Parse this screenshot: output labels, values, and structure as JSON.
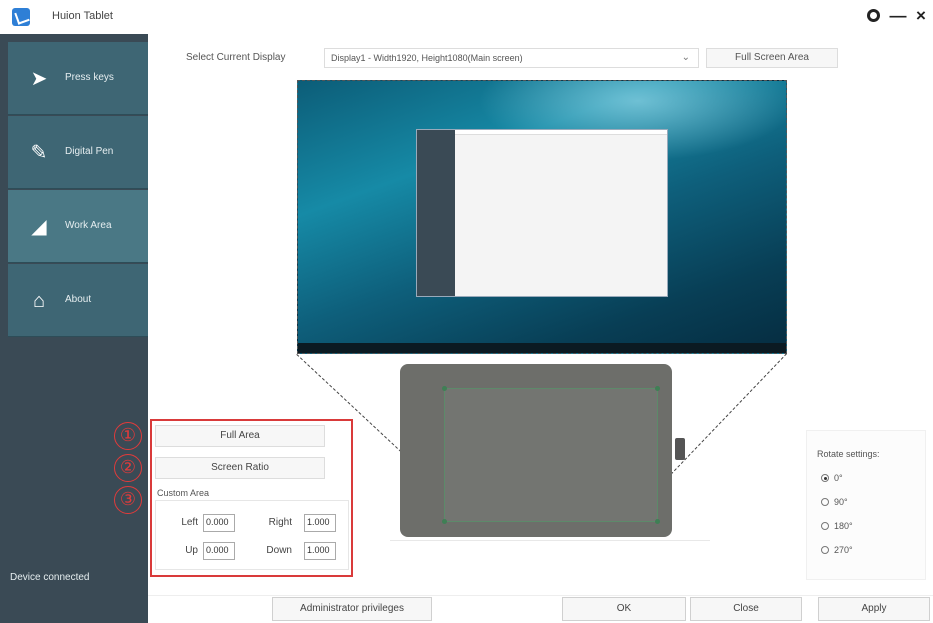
{
  "window": {
    "title": "Huion Tablet",
    "settings_icon": "gear-icon",
    "minimize_glyph": "—",
    "close_glyph": "×"
  },
  "sidebar": {
    "items": [
      {
        "label": "Press keys",
        "icon": "send-icon",
        "glyph": "➤"
      },
      {
        "label": "Digital Pen",
        "icon": "pen-icon",
        "glyph": "✎"
      },
      {
        "label": "Work Area",
        "icon": "triangle-icon",
        "glyph": "◢"
      },
      {
        "label": "About",
        "icon": "home-icon",
        "glyph": "⌂"
      }
    ],
    "active": "Work Area",
    "status": "Device connected"
  },
  "display": {
    "label": "Select Current Display",
    "selected": "Display1 - Width1920, Height1080(Main screen)",
    "arrow": "⌄",
    "full_screen_label": "Full Screen Area"
  },
  "work_area": {
    "markers": [
      "①",
      "②",
      "③"
    ],
    "full_area_label": "Full Area",
    "screen_ratio_label": "Screen Ratio",
    "custom_area_label": "Custom Area",
    "fields": {
      "left_label": "Left",
      "left_value": "0.000",
      "right_label": "Right",
      "right_value": "1.000",
      "up_label": "Up",
      "up_value": "0.000",
      "down_label": "Down",
      "down_value": "1.000"
    }
  },
  "rotate": {
    "title": "Rotate settings:",
    "options": [
      "0°",
      "90°",
      "180°",
      "270°"
    ],
    "selected": "0°"
  },
  "buttons": {
    "admin": "Administrator privileges",
    "ok": "OK",
    "close": "Close",
    "apply": "Apply"
  },
  "colors": {
    "sidebar": "#3a4a55",
    "nav_item": "#3e6674",
    "highlight": "#d93a3a"
  }
}
